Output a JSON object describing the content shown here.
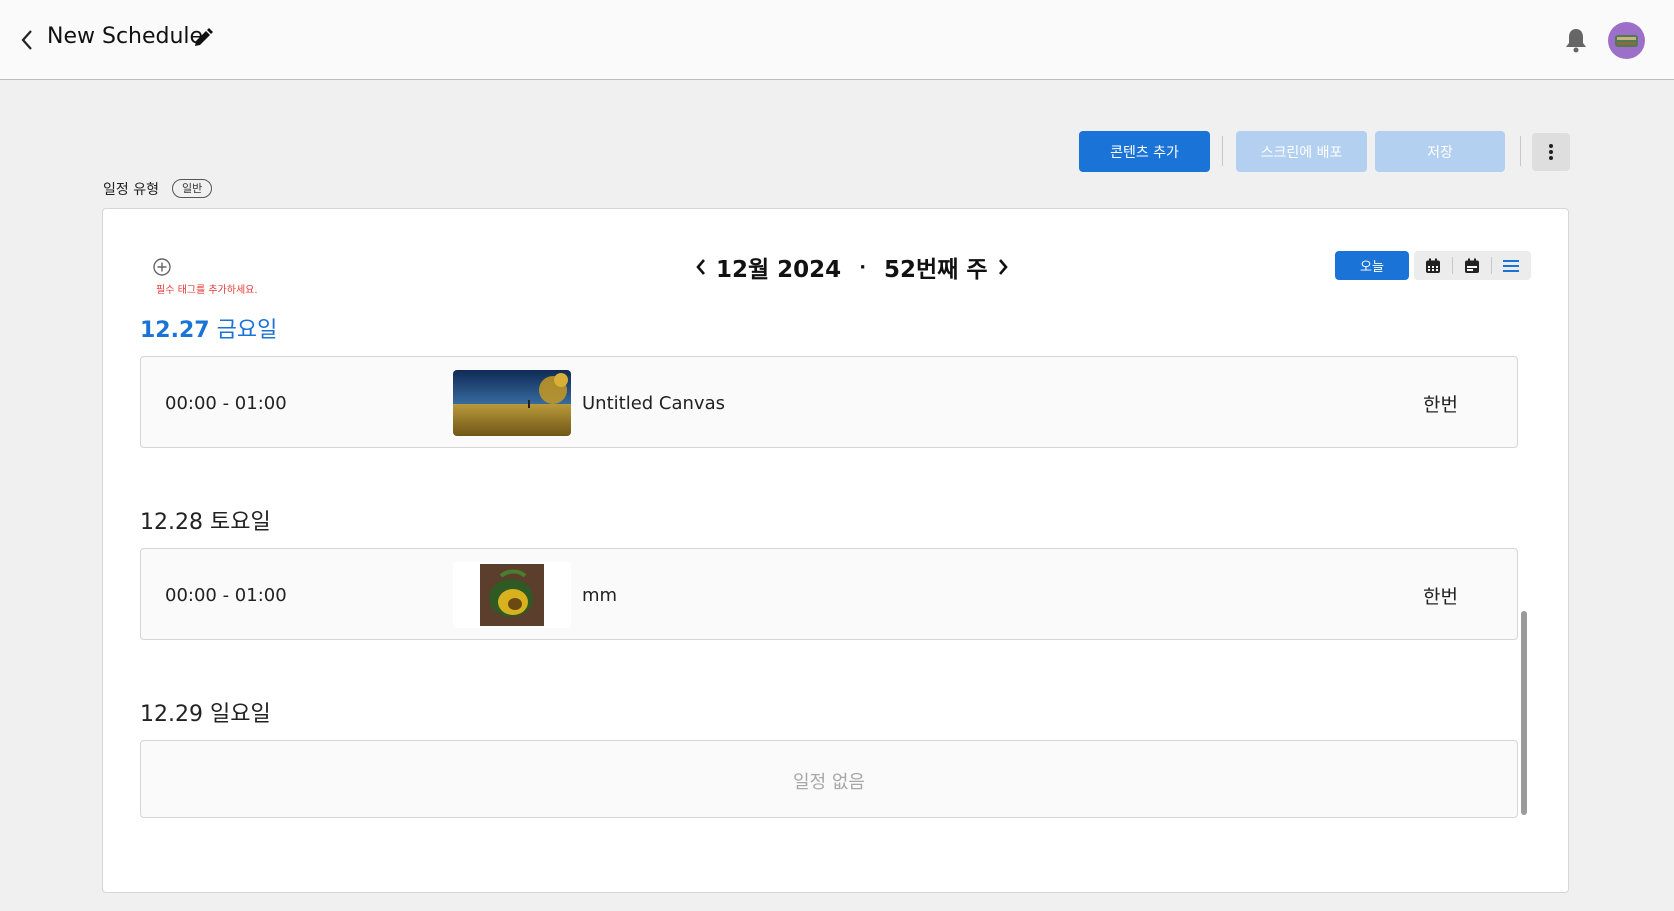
{
  "header": {
    "title": "New Schedule",
    "back_icon": "chevron-left-icon",
    "edit_icon": "pencil-icon",
    "notification_icon": "bell-icon"
  },
  "toolbar": {
    "add_content_label": "콘텐츠 추가",
    "deploy_label": "스크린에 배포",
    "save_label": "저장",
    "more_icon": "kebab-menu-icon"
  },
  "schedule_type": {
    "label": "일정 유형",
    "value": "일반"
  },
  "tags": {
    "hint": "필수 태그를 추가하세요."
  },
  "calendar": {
    "month_year": "12월 2024",
    "separator": "·",
    "week": "52번째 주",
    "today_label": "오늘",
    "views": [
      "week-calendar-icon",
      "day-calendar-icon",
      "list-view-icon"
    ],
    "active_view": "list-view-icon"
  },
  "days": [
    {
      "date": "12.27",
      "weekday": "금요일",
      "is_today": true,
      "events": [
        {
          "time": "00:00 - 01:00",
          "title": "Untitled Canvas",
          "repeat": "한번",
          "thumb": "landscape"
        }
      ]
    },
    {
      "date": "12.28",
      "weekday": "토요일",
      "is_today": false,
      "events": [
        {
          "time": "00:00 - 01:00",
          "title": "mm",
          "repeat": "한번",
          "thumb": "fruit"
        }
      ]
    },
    {
      "date": "12.29",
      "weekday": "일요일",
      "is_today": false,
      "events": [],
      "empty_label": "일정 없음"
    }
  ],
  "colors": {
    "primary": "#1a73d6",
    "primary_disabled": "#b3d0f0",
    "error": "#e53935"
  }
}
